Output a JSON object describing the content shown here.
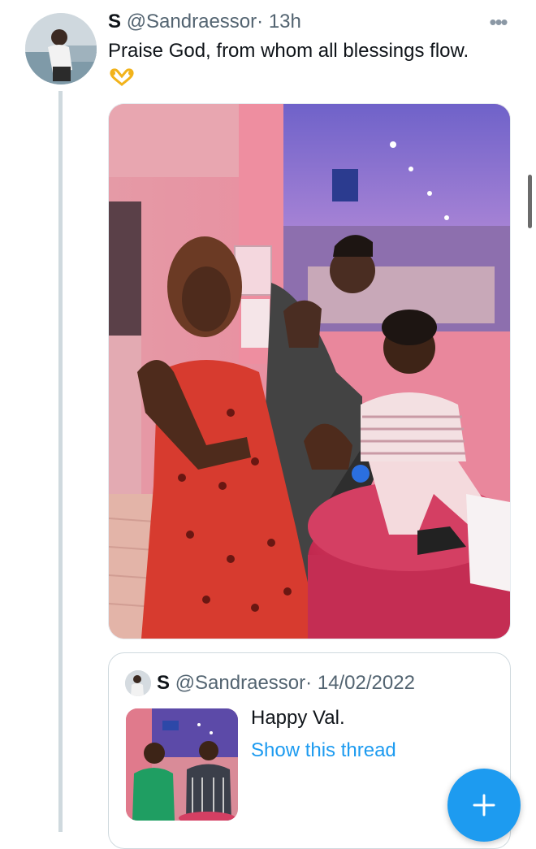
{
  "tweet": {
    "display_name": "S",
    "handle": "@Sandraessor",
    "separator": "·",
    "time": "13h",
    "text": "Praise God, from whom all blessings flow.",
    "emoji": "heart-hands",
    "more_label": "•••"
  },
  "quoted_tweet": {
    "display_name": "S",
    "handle": "@Sandraessor",
    "separator": "·",
    "date": "14/02/2022",
    "text": "Happy Val.",
    "link_label": "Show this thread"
  },
  "colors": {
    "accent": "#1d9bf0",
    "text_primary": "#0f1419",
    "text_secondary": "#536471",
    "thread_line": "#cfd9de"
  },
  "icons": {
    "more": "more-dots-icon",
    "compose": "plus-icon"
  }
}
